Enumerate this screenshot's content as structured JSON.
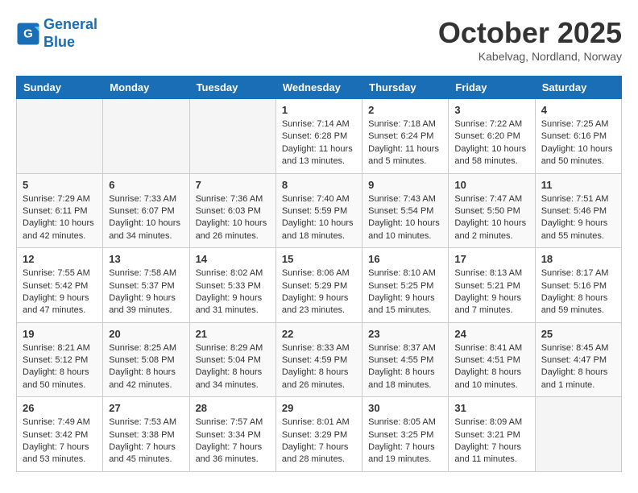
{
  "header": {
    "logo_line1": "General",
    "logo_line2": "Blue",
    "month_title": "October 2025",
    "subtitle": "Kabelvag, Nordland, Norway"
  },
  "weekdays": [
    "Sunday",
    "Monday",
    "Tuesday",
    "Wednesday",
    "Thursday",
    "Friday",
    "Saturday"
  ],
  "weeks": [
    [
      {
        "day": "",
        "info": ""
      },
      {
        "day": "",
        "info": ""
      },
      {
        "day": "",
        "info": ""
      },
      {
        "day": "1",
        "info": "Sunrise: 7:14 AM\nSunset: 6:28 PM\nDaylight: 11 hours\nand 13 minutes."
      },
      {
        "day": "2",
        "info": "Sunrise: 7:18 AM\nSunset: 6:24 PM\nDaylight: 11 hours\nand 5 minutes."
      },
      {
        "day": "3",
        "info": "Sunrise: 7:22 AM\nSunset: 6:20 PM\nDaylight: 10 hours\nand 58 minutes."
      },
      {
        "day": "4",
        "info": "Sunrise: 7:25 AM\nSunset: 6:16 PM\nDaylight: 10 hours\nand 50 minutes."
      }
    ],
    [
      {
        "day": "5",
        "info": "Sunrise: 7:29 AM\nSunset: 6:11 PM\nDaylight: 10 hours\nand 42 minutes."
      },
      {
        "day": "6",
        "info": "Sunrise: 7:33 AM\nSunset: 6:07 PM\nDaylight: 10 hours\nand 34 minutes."
      },
      {
        "day": "7",
        "info": "Sunrise: 7:36 AM\nSunset: 6:03 PM\nDaylight: 10 hours\nand 26 minutes."
      },
      {
        "day": "8",
        "info": "Sunrise: 7:40 AM\nSunset: 5:59 PM\nDaylight: 10 hours\nand 18 minutes."
      },
      {
        "day": "9",
        "info": "Sunrise: 7:43 AM\nSunset: 5:54 PM\nDaylight: 10 hours\nand 10 minutes."
      },
      {
        "day": "10",
        "info": "Sunrise: 7:47 AM\nSunset: 5:50 PM\nDaylight: 10 hours\nand 2 minutes."
      },
      {
        "day": "11",
        "info": "Sunrise: 7:51 AM\nSunset: 5:46 PM\nDaylight: 9 hours\nand 55 minutes."
      }
    ],
    [
      {
        "day": "12",
        "info": "Sunrise: 7:55 AM\nSunset: 5:42 PM\nDaylight: 9 hours\nand 47 minutes."
      },
      {
        "day": "13",
        "info": "Sunrise: 7:58 AM\nSunset: 5:37 PM\nDaylight: 9 hours\nand 39 minutes."
      },
      {
        "day": "14",
        "info": "Sunrise: 8:02 AM\nSunset: 5:33 PM\nDaylight: 9 hours\nand 31 minutes."
      },
      {
        "day": "15",
        "info": "Sunrise: 8:06 AM\nSunset: 5:29 PM\nDaylight: 9 hours\nand 23 minutes."
      },
      {
        "day": "16",
        "info": "Sunrise: 8:10 AM\nSunset: 5:25 PM\nDaylight: 9 hours\nand 15 minutes."
      },
      {
        "day": "17",
        "info": "Sunrise: 8:13 AM\nSunset: 5:21 PM\nDaylight: 9 hours\nand 7 minutes."
      },
      {
        "day": "18",
        "info": "Sunrise: 8:17 AM\nSunset: 5:16 PM\nDaylight: 8 hours\nand 59 minutes."
      }
    ],
    [
      {
        "day": "19",
        "info": "Sunrise: 8:21 AM\nSunset: 5:12 PM\nDaylight: 8 hours\nand 50 minutes."
      },
      {
        "day": "20",
        "info": "Sunrise: 8:25 AM\nSunset: 5:08 PM\nDaylight: 8 hours\nand 42 minutes."
      },
      {
        "day": "21",
        "info": "Sunrise: 8:29 AM\nSunset: 5:04 PM\nDaylight: 8 hours\nand 34 minutes."
      },
      {
        "day": "22",
        "info": "Sunrise: 8:33 AM\nSunset: 4:59 PM\nDaylight: 8 hours\nand 26 minutes."
      },
      {
        "day": "23",
        "info": "Sunrise: 8:37 AM\nSunset: 4:55 PM\nDaylight: 8 hours\nand 18 minutes."
      },
      {
        "day": "24",
        "info": "Sunrise: 8:41 AM\nSunset: 4:51 PM\nDaylight: 8 hours\nand 10 minutes."
      },
      {
        "day": "25",
        "info": "Sunrise: 8:45 AM\nSunset: 4:47 PM\nDaylight: 8 hours\nand 1 minute."
      }
    ],
    [
      {
        "day": "26",
        "info": "Sunrise: 7:49 AM\nSunset: 3:42 PM\nDaylight: 7 hours\nand 53 minutes."
      },
      {
        "day": "27",
        "info": "Sunrise: 7:53 AM\nSunset: 3:38 PM\nDaylight: 7 hours\nand 45 minutes."
      },
      {
        "day": "28",
        "info": "Sunrise: 7:57 AM\nSunset: 3:34 PM\nDaylight: 7 hours\nand 36 minutes."
      },
      {
        "day": "29",
        "info": "Sunrise: 8:01 AM\nSunset: 3:29 PM\nDaylight: 7 hours\nand 28 minutes."
      },
      {
        "day": "30",
        "info": "Sunrise: 8:05 AM\nSunset: 3:25 PM\nDaylight: 7 hours\nand 19 minutes."
      },
      {
        "day": "31",
        "info": "Sunrise: 8:09 AM\nSunset: 3:21 PM\nDaylight: 7 hours\nand 11 minutes."
      },
      {
        "day": "",
        "info": ""
      }
    ]
  ]
}
